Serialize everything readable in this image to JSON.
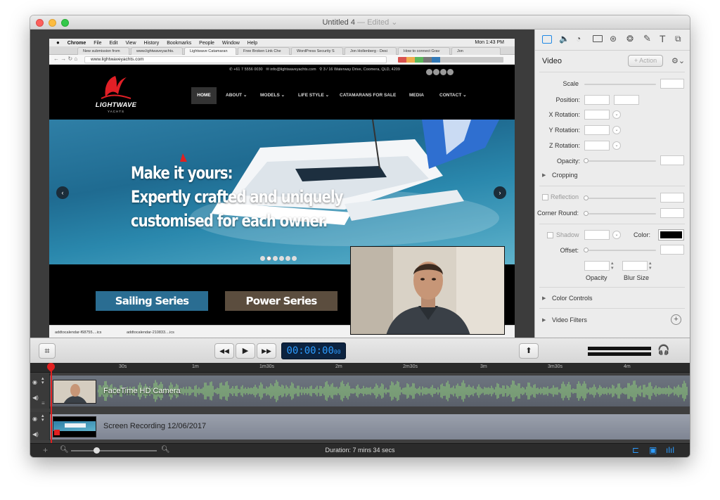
{
  "window": {
    "title": "Untitled 4",
    "edited": " — Edited ⌄"
  },
  "browser": {
    "menubar": [
      "Chrome",
      "File",
      "Edit",
      "View",
      "History",
      "Bookmarks",
      "People",
      "Window",
      "Help"
    ],
    "clock": "Mon 1:43 PM",
    "tabs": [
      "New submission from",
      "www.lightwaveyachts.",
      "Lightwave Catamaran",
      "Free Broken Link Che",
      "WordPress Security S",
      "Jon Hollenberg - Desi",
      "How to connect Grav",
      "Jon"
    ],
    "url": "www.lightwaveyachts.com",
    "downloads": [
      "addtocalendar-f68755....ics",
      "addtocalendar-210833....ics"
    ]
  },
  "site": {
    "phone": "+61 7 5556 0030",
    "email": "info@lightwaveyachts.com",
    "address": "3 / 16 Waterway Drive, Coomera, QLD, 4209",
    "logo_text": "LIGHTWAVE",
    "logo_sub": "YACHTS",
    "nav": [
      "HOME",
      "ABOUT ⌄",
      "MODELS ⌄",
      "LIFE STYLE ⌄",
      "CATAMARANS FOR SALE",
      "MEDIA",
      "CONTACT ⌄"
    ],
    "headline": [
      "Make it yours:",
      "Expertly crafted and uniquely",
      "customised for each owner."
    ],
    "series": [
      "Sailing Series",
      "Power Series"
    ]
  },
  "panel": {
    "heading": "Video",
    "action_button": "+ Action",
    "labels": {
      "scale": "Scale",
      "position": "Position:",
      "xrot": "X Rotation:",
      "yrot": "Y Rotation:",
      "zrot": "Z Rotation:",
      "opacity": "Opacity:",
      "cropping": "Cropping",
      "reflection": "Reflection",
      "corner": "Corner Round:",
      "shadow": "Shadow",
      "color": "Color:",
      "offset": "Offset:",
      "shadow_opacity": "Opacity",
      "blur": "Blur Size",
      "color_controls": "Color Controls",
      "video_filters": "Video Filters"
    }
  },
  "transport": {
    "timecode": "00:00:00",
    "frames": "00"
  },
  "timeline": {
    "ruler": [
      "30s",
      "1m",
      "1m30s",
      "2m",
      "2m30s",
      "3m",
      "3m30s",
      "4m"
    ],
    "tracks": [
      "FaceTime HD Camera",
      "Screen Recording 12/06/2017"
    ],
    "duration": "Duration: 7 mins 34 secs"
  },
  "colors": {
    "accent": "#1e88e5",
    "waveform": "#8fd07a",
    "playhead": "#e02020",
    "timecode_bg": "#0c2340",
    "timecode_text": "#2d9cff"
  }
}
